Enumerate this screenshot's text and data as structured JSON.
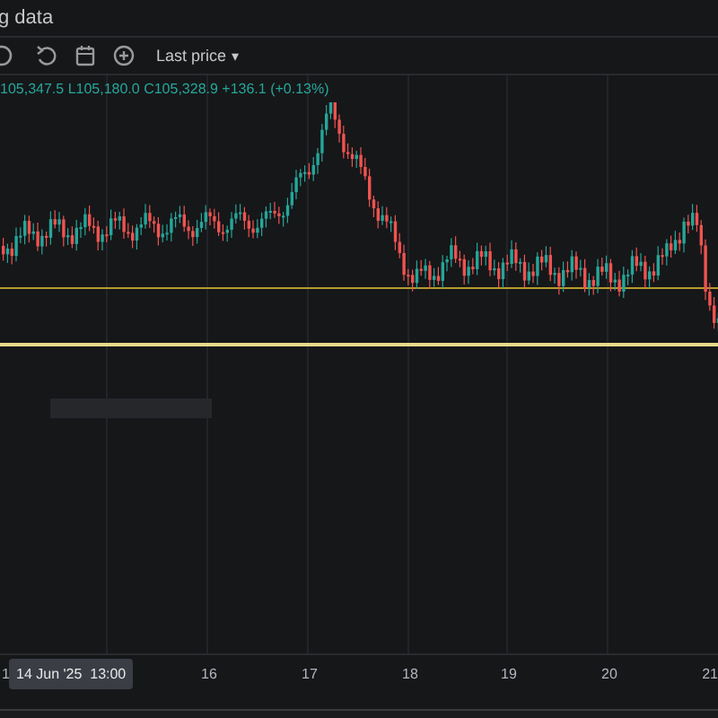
{
  "header": {
    "title": "g data"
  },
  "toolbar": {
    "price_menu": "Last price",
    "caret": "▾"
  },
  "legend": {
    "ohlc": "105,347.5 L105,180.0 C105,328.9 +136.1 (+0.13%)"
  },
  "time_axis": {
    "labels": [
      "1",
      "16",
      "17",
      "18",
      "19",
      "20",
      "21"
    ],
    "crosshair_label": "14 Jun '25  13:00"
  }
}
